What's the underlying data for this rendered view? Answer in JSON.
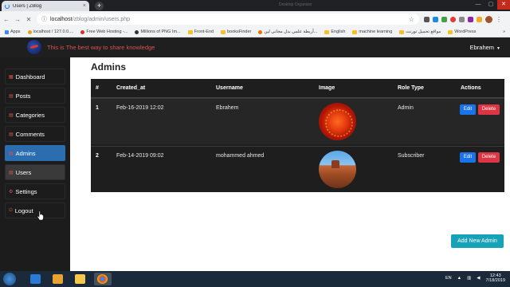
{
  "browser": {
    "tab_title": "Users | ZBlog",
    "tab_close": "×",
    "new_tab": "+",
    "ghost_tab": "Desktop Organizer",
    "url_host": "localhost",
    "url_path": "/zblog/admin/users.php",
    "back": "←",
    "forward": "→",
    "reload": "✕",
    "bookmarks": [
      {
        "label": "Apps",
        "kind": "apps"
      },
      {
        "label": "localhost / 127.0.0....",
        "kind": "favicon",
        "color": "#e4a11b"
      },
      {
        "label": "Free Web Hosting -...",
        "kind": "favicon",
        "color": "#d93025"
      },
      {
        "label": "Millions of PNG Im...",
        "kind": "favicon",
        "color": "#333333"
      },
      {
        "label": "Front-End",
        "kind": "folder"
      },
      {
        "label": "booksFinder",
        "kind": "folder"
      },
      {
        "label": "أربطة علمي بدل مجانى لين...",
        "kind": "favicon",
        "color": "#e8710a"
      },
      {
        "label": "English",
        "kind": "folder"
      },
      {
        "label": "machine learning",
        "kind": "folder"
      },
      {
        "label": "مواقع تحميل تورنت",
        "kind": "folder"
      },
      {
        "label": "WordPress",
        "kind": "folder"
      }
    ],
    "more_bookmarks": "»"
  },
  "app": {
    "brand_text": "This is The best way to share knowledge",
    "user_name": "Ebrahem",
    "sidebar": [
      {
        "label": "Dashboard",
        "active": false
      },
      {
        "label": "Posts",
        "active": false
      },
      {
        "label": "Categories",
        "active": false
      },
      {
        "label": "Comments",
        "active": false
      },
      {
        "label": "Admins",
        "active": true
      },
      {
        "label": "Users",
        "active": false
      },
      {
        "label": "Settings",
        "active": false
      },
      {
        "label": "Logout",
        "active": false
      }
    ],
    "page_title": "Admins",
    "table": {
      "columns": [
        "#",
        "Created_at",
        "Username",
        "Image",
        "Role Type",
        "Actions"
      ],
      "rows": [
        {
          "num": "1",
          "created_at": "Feb-16-2019 12:02",
          "username": "Ebrahem",
          "role": "Admin"
        },
        {
          "num": "2",
          "created_at": "Feb-14-2019 09:02",
          "username": "mohammed ahmed",
          "role": "Subscriber"
        }
      ],
      "edit_label": "Edit",
      "delete_label": "Delete"
    },
    "add_button": "Add New Admin"
  },
  "taskbar": {
    "language": "EN",
    "time": "12:43",
    "date": "7/18/2019"
  }
}
